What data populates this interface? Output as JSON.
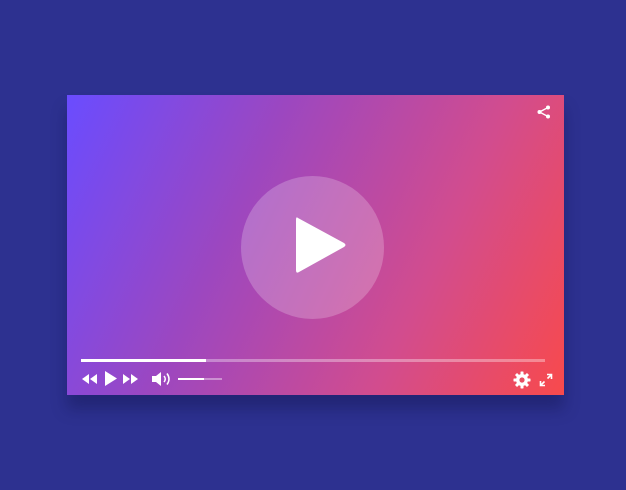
{
  "player": {
    "gradient_colors": [
      "#6a4cff",
      "#9c47c0",
      "#d24c8e",
      "#f84a4c"
    ],
    "background_color": "#2d3190",
    "playback_progress": 0.27,
    "volume_level": 0.6,
    "icons": {
      "share": "share-icon",
      "big_play": "play-icon",
      "rewind": "rewind-icon",
      "play": "play-icon",
      "fast_forward": "fast-forward-icon",
      "volume": "volume-icon",
      "settings": "gear-icon",
      "fullscreen": "fullscreen-icon"
    }
  }
}
